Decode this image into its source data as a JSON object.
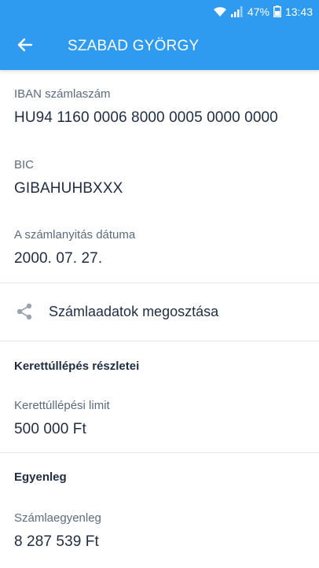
{
  "status_bar": {
    "battery": "47%",
    "time": "13:43"
  },
  "header": {
    "title": "SZABAD GYÖRGY",
    "back_icon": "arrow-left-icon"
  },
  "account": {
    "iban_label": "IBAN számlaszám",
    "iban_value": "HU94 1160 0006 8000 0005 0000 0000",
    "bic_label": "BIC",
    "bic_value": "GIBAHUHBXXX",
    "opening_label": "A számlanyitás dátuma",
    "opening_value": "2000. 07. 27."
  },
  "share": {
    "icon": "share-icon",
    "label": "Számlaadatok megosztása"
  },
  "overdraft": {
    "heading": "Kerettúllépés részletei",
    "limit_label": "Kerettúllépési limit",
    "limit_value": "500 000 Ft"
  },
  "balance": {
    "heading": "Egyenleg",
    "balance_label": "Számlaegyenleg",
    "balance_value": "8 287 539 Ft"
  },
  "colors": {
    "primary": "#2e9bf0",
    "text": "#1f2d44",
    "label": "#5b6b80"
  }
}
